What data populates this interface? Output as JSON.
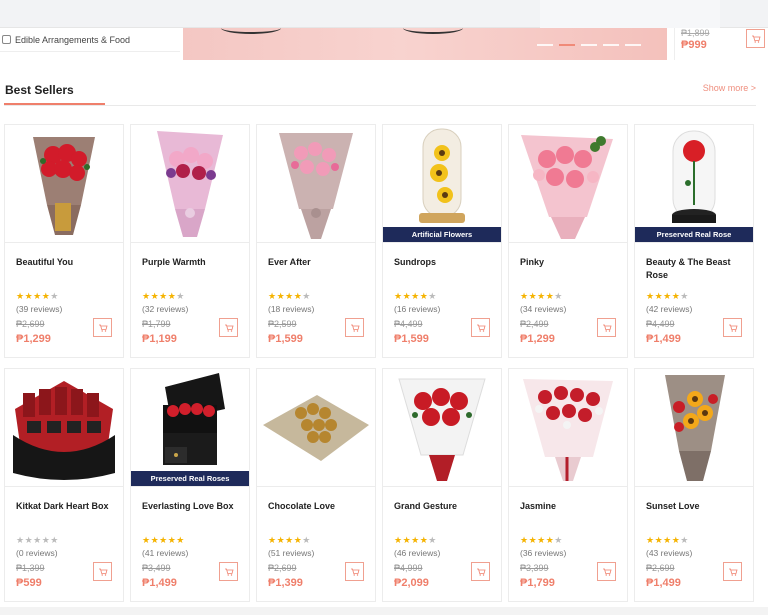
{
  "top_category": "Edible Arrangements & Food",
  "mini_product": {
    "old_price": "₱1,899",
    "price": "₱999"
  },
  "section": {
    "title": "Best Sellers",
    "show_more": "Show more >"
  },
  "colors": {
    "accent": "#ef7f6b",
    "ribbon": "#1e2a5a",
    "star": "#f5b301"
  },
  "products": [
    {
      "name": "Beautiful You",
      "stars": 4.5,
      "reviews": "(39 reviews)",
      "old_price": "₱2,699",
      "price": "₱1,299",
      "ribbon": ""
    },
    {
      "name": "Purple Warmth",
      "stars": 4.5,
      "reviews": "(32 reviews)",
      "old_price": "₱1,799",
      "price": "₱1,199",
      "ribbon": ""
    },
    {
      "name": "Ever After",
      "stars": 4.5,
      "reviews": "(18 reviews)",
      "old_price": "₱2,599",
      "price": "₱1,599",
      "ribbon": ""
    },
    {
      "name": "Sundrops",
      "stars": 4.5,
      "reviews": "(16 reviews)",
      "old_price": "₱4,499",
      "price": "₱1,599",
      "ribbon": "Artificial Flowers"
    },
    {
      "name": "Pinky",
      "stars": 4.5,
      "reviews": "(34 reviews)",
      "old_price": "₱2,499",
      "price": "₱1,299",
      "ribbon": ""
    },
    {
      "name": "Beauty & The Beast Rose",
      "stars": 4.5,
      "reviews": "(42 reviews)",
      "old_price": "₱4,499",
      "price": "₱1,499",
      "ribbon": "Preserved Real Rose"
    },
    {
      "name": "Kitkat Dark Heart Box",
      "stars": 0,
      "reviews": "(0 reviews)",
      "old_price": "₱1,399",
      "price": "₱599",
      "ribbon": ""
    },
    {
      "name": "Everlasting Love Box",
      "stars": 5,
      "reviews": "(41 reviews)",
      "old_price": "₱3,499",
      "price": "₱1,499",
      "ribbon": "Preserved Real Roses"
    },
    {
      "name": "Chocolate Love",
      "stars": 4.5,
      "reviews": "(51 reviews)",
      "old_price": "₱2,699",
      "price": "₱1,399",
      "ribbon": ""
    },
    {
      "name": "Grand Gesture",
      "stars": 4.5,
      "reviews": "(46 reviews)",
      "old_price": "₱4,999",
      "price": "₱2,099",
      "ribbon": ""
    },
    {
      "name": "Jasmine",
      "stars": 4.5,
      "reviews": "(36 reviews)",
      "old_price": "₱3,399",
      "price": "₱1,799",
      "ribbon": ""
    },
    {
      "name": "Sunset Love",
      "stars": 4.5,
      "reviews": "(43 reviews)",
      "old_price": "₱2,699",
      "price": "₱1,499",
      "ribbon": ""
    }
  ]
}
